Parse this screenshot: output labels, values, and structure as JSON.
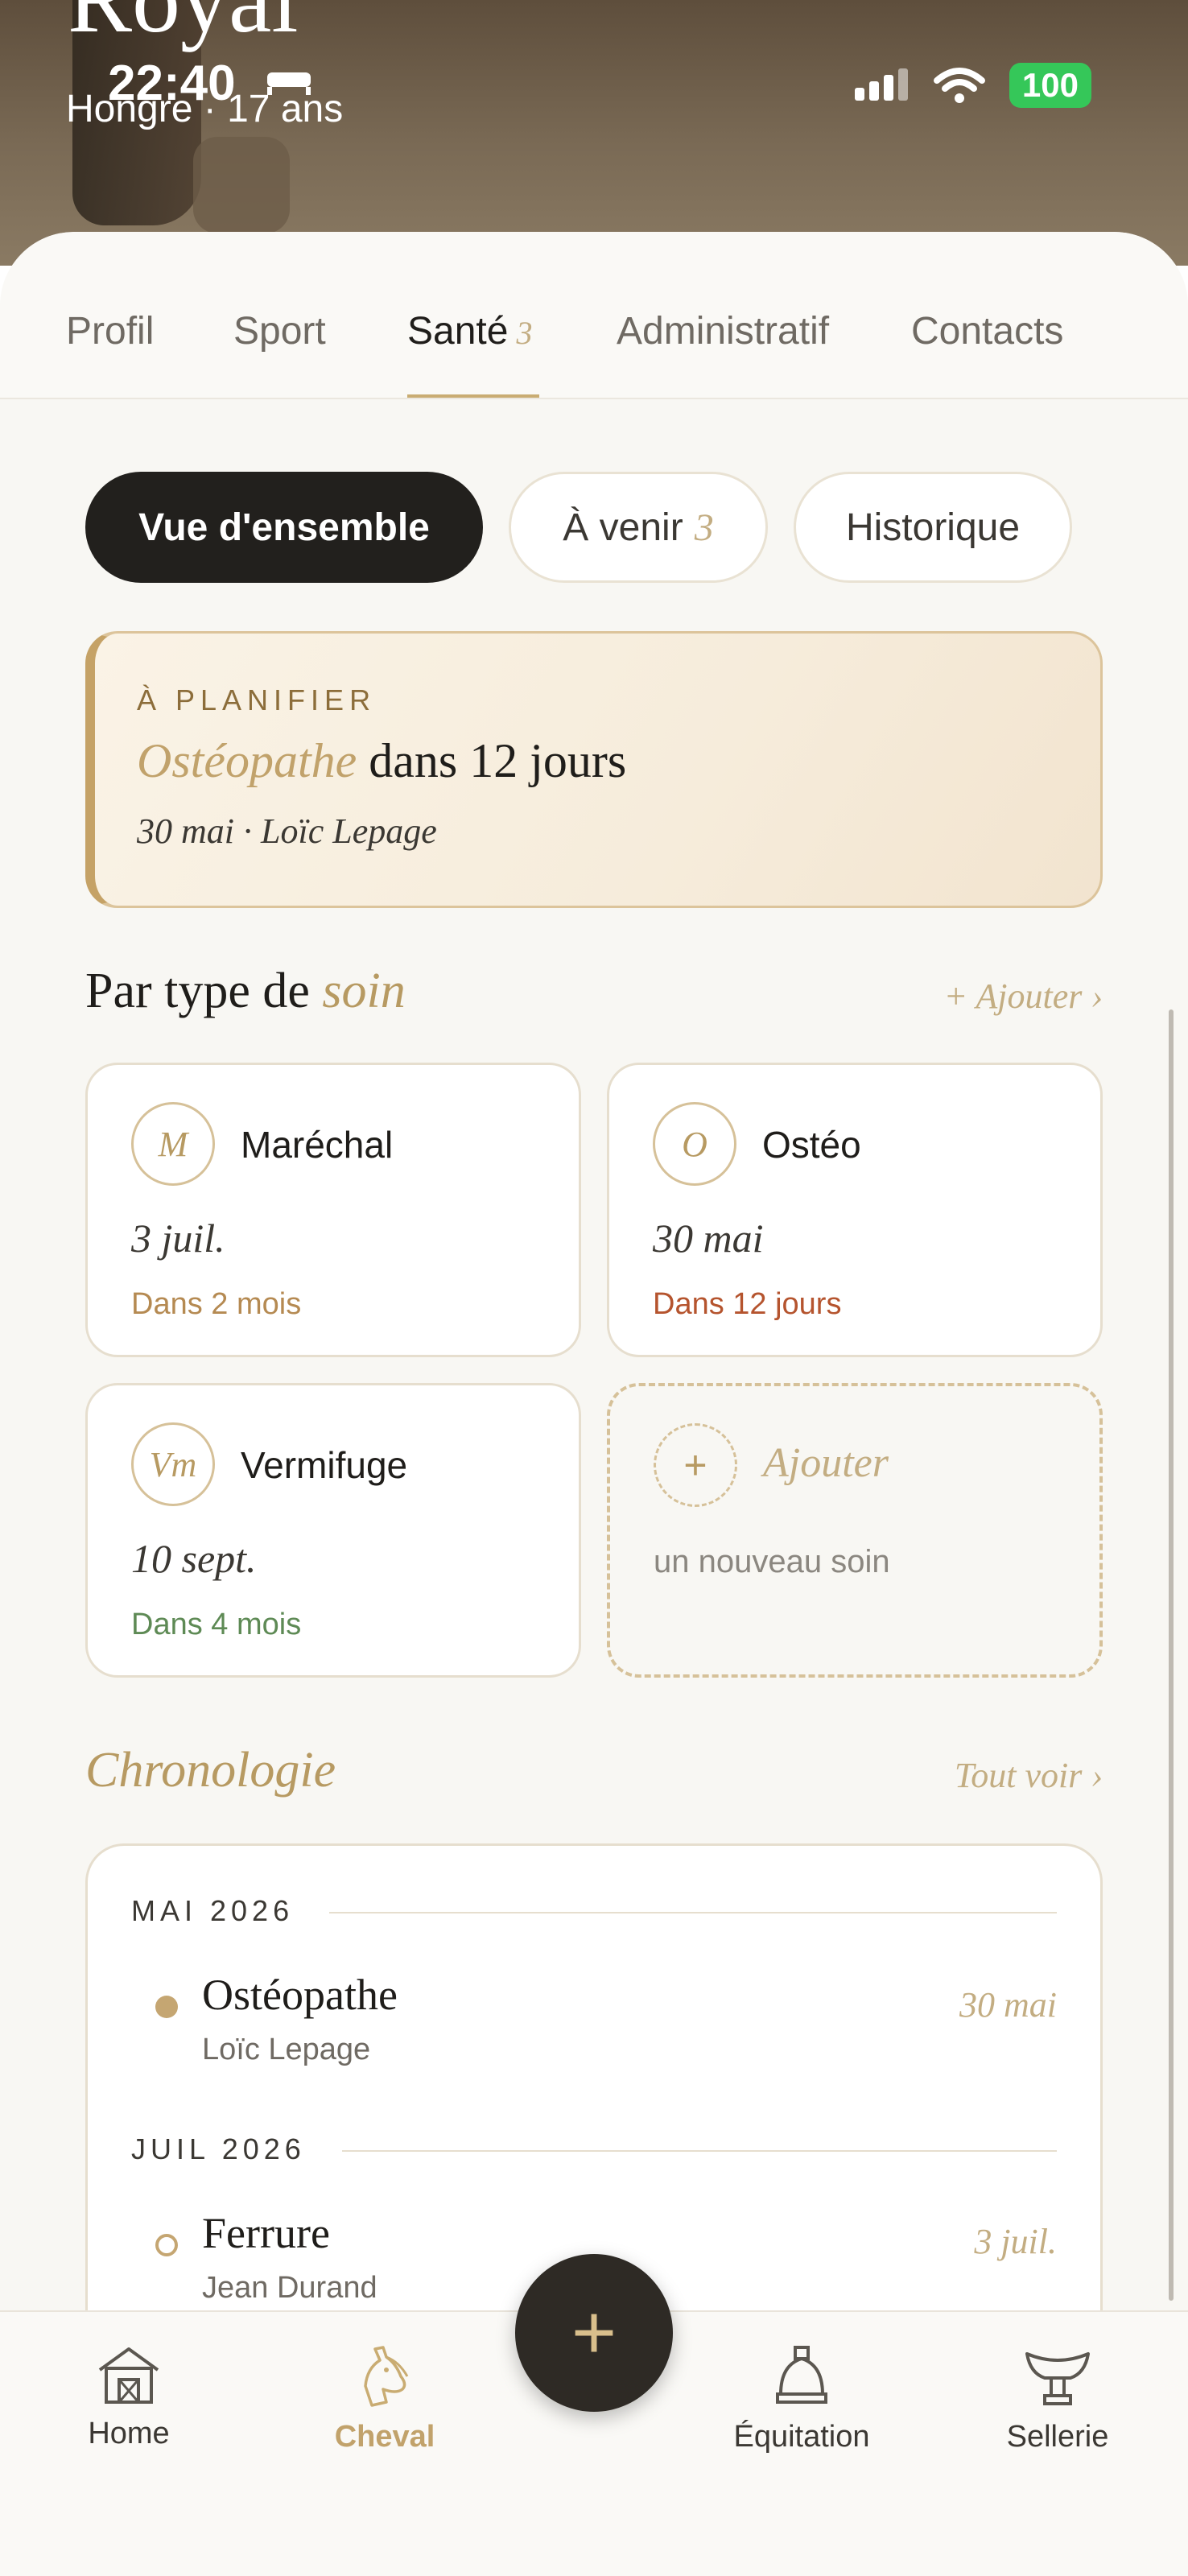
{
  "status_bar": {
    "time": "22:40",
    "battery": "100"
  },
  "hero": {
    "name": "Royal",
    "subtitle": "Hongre · 17 ans"
  },
  "tabs": [
    {
      "label": "Profil"
    },
    {
      "label": "Sport"
    },
    {
      "label": "Santé",
      "badge": "3"
    },
    {
      "label": "Administratif"
    },
    {
      "label": "Contacts"
    }
  ],
  "segments": {
    "overview": "Vue d'ensemble",
    "upcoming": "À venir",
    "upcoming_badge": "3",
    "history": "Historique"
  },
  "plan_card": {
    "kicker": "À PLANIFIER",
    "title_accent": "Ostéopathe",
    "title_rest": "dans 12 jours",
    "subtitle": "30 mai · Loïc Lepage"
  },
  "care_section": {
    "title_plain": "Par type de",
    "title_accent": "soin",
    "add_link": "+ Ajouter ›",
    "items": [
      {
        "initial": "M",
        "name": "Maréchal",
        "date": "3 juil.",
        "due": "Dans 2 mois",
        "due_color": "#b58a52"
      },
      {
        "initial": "O",
        "name": "Ostéo",
        "date": "30 mai",
        "due": "Dans 12 jours",
        "due_color": "#b5542e"
      },
      {
        "initial": "Vm",
        "name": "Vermifuge",
        "date": "10 sept.",
        "due": "Dans 4 mois",
        "due_color": "#5e8a55"
      }
    ],
    "add_card": {
      "icon": "+",
      "label": "Ajouter",
      "note": "un nouveau soin"
    }
  },
  "chronology": {
    "title": "Chronologie",
    "see_all": "Tout voir ›",
    "groups": [
      {
        "month": "MAI 2026",
        "event": {
          "title": "Ostéopathe",
          "who": "Loïc Lepage",
          "date": "30 mai"
        }
      },
      {
        "month": "JUIL 2026",
        "event": {
          "title": "Ferrure",
          "who": "Jean Durand",
          "date": "3 juil."
        }
      }
    ]
  },
  "bottom_nav": {
    "items": [
      {
        "label": "Home",
        "icon": "barn-icon"
      },
      {
        "label": "Cheval",
        "icon": "horse-head-icon",
        "active": true
      },
      {
        "label": "Équitation",
        "icon": "stirrup-icon"
      },
      {
        "label": "Sellerie",
        "icon": "saddle-icon"
      }
    ],
    "fab": "+"
  },
  "colors": {
    "accent": "#c1a26b",
    "dark": "#22201d",
    "background": "#f8f7f3"
  }
}
